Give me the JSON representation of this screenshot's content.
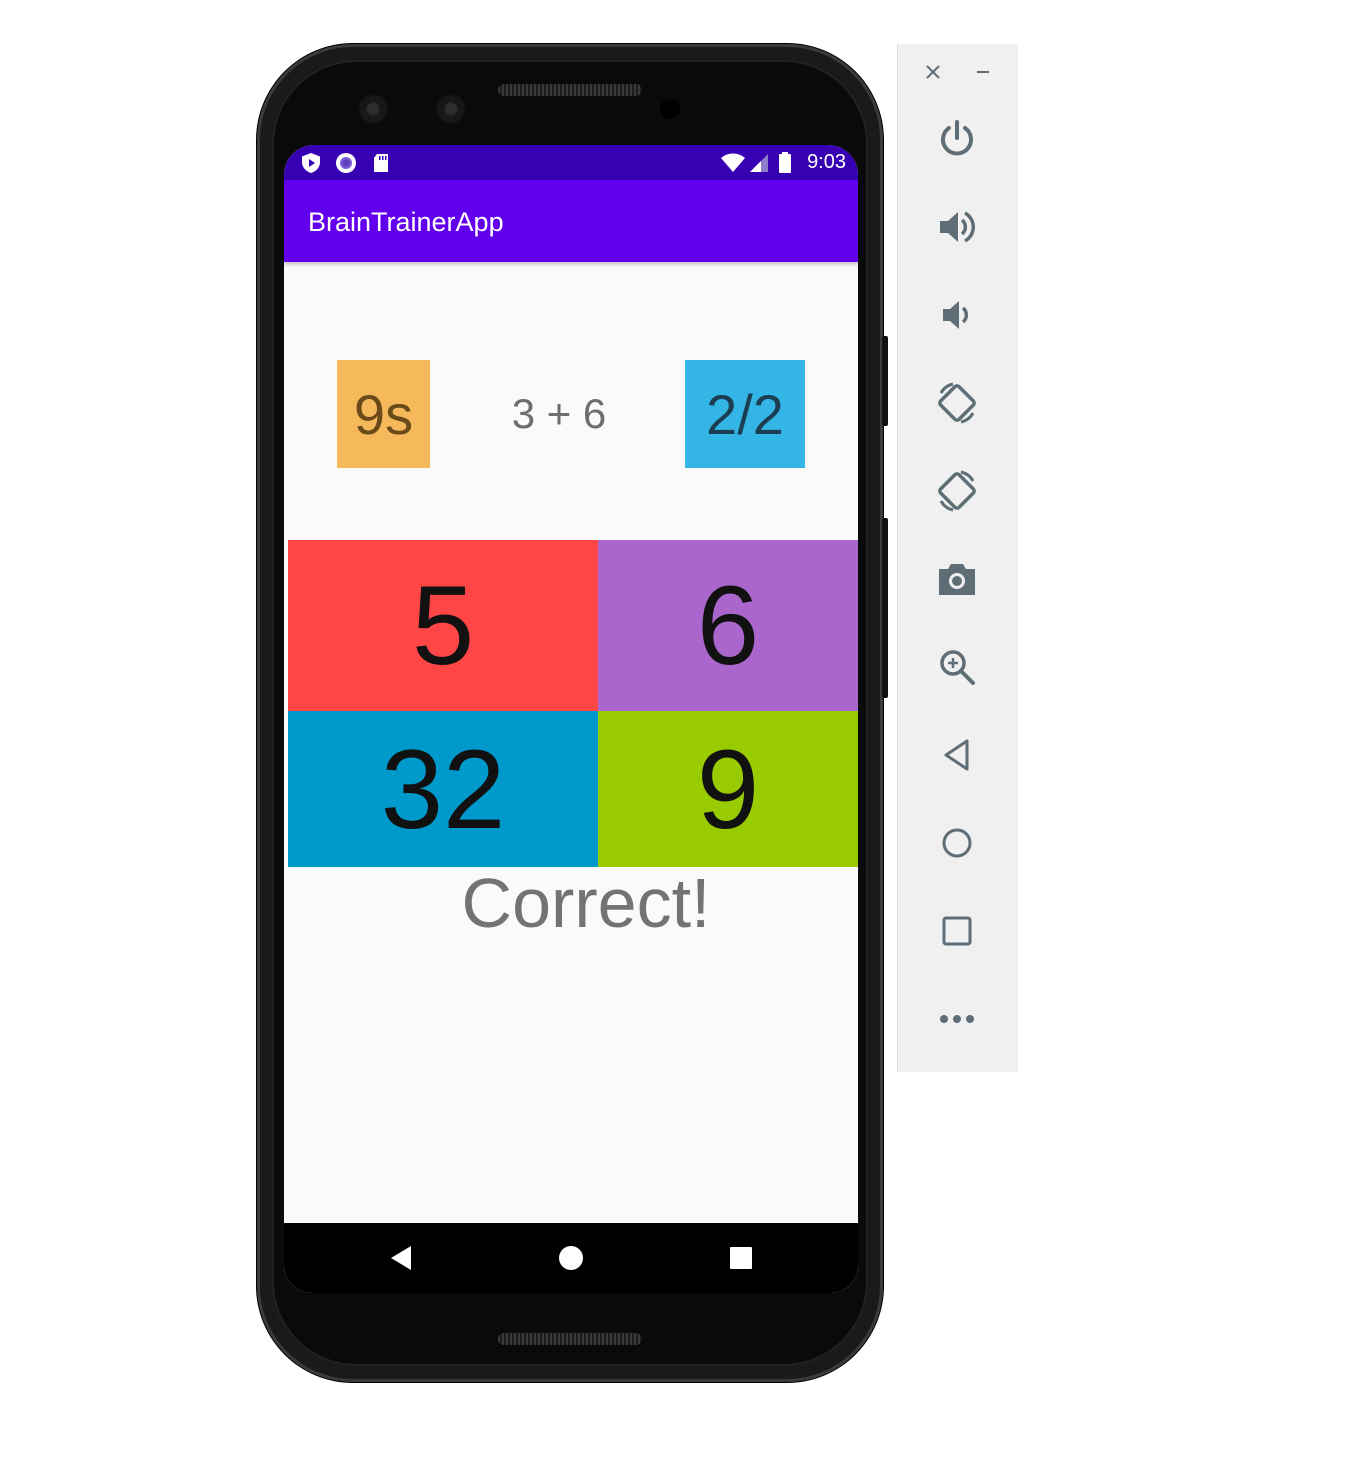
{
  "app": {
    "title": "BrainTrainerApp"
  },
  "status_bar": {
    "time": "9:03",
    "left_icons": [
      "play-protect-icon",
      "circle-notification-icon",
      "sd-card-icon"
    ],
    "right_icons": [
      "wifi-icon",
      "signal-icon",
      "battery-icon"
    ]
  },
  "game": {
    "timer": "9s",
    "question": "3 + 6",
    "score": "2/2",
    "answers": [
      "5",
      "6",
      "32",
      "9"
    ],
    "result": "Correct!"
  },
  "colors": {
    "status_bar": "#3700b3",
    "app_bar": "#6200ee",
    "timer_bg": "#f5b85a",
    "score_bg": "#33b5e5",
    "answer_colors": [
      "#ff4646",
      "#aa66cc",
      "#0099cc",
      "#99cc00"
    ]
  },
  "navigation": [
    "back-icon",
    "home-icon",
    "recents-icon"
  ],
  "emulator_controls": {
    "window": [
      "close-icon",
      "minimize-icon"
    ],
    "buttons": [
      "power-icon",
      "volume-up-icon",
      "volume-down-icon",
      "rotate-left-icon",
      "rotate-right-icon",
      "camera-icon",
      "zoom-icon",
      "back-icon",
      "home-icon",
      "overview-icon",
      "more-icon"
    ]
  }
}
